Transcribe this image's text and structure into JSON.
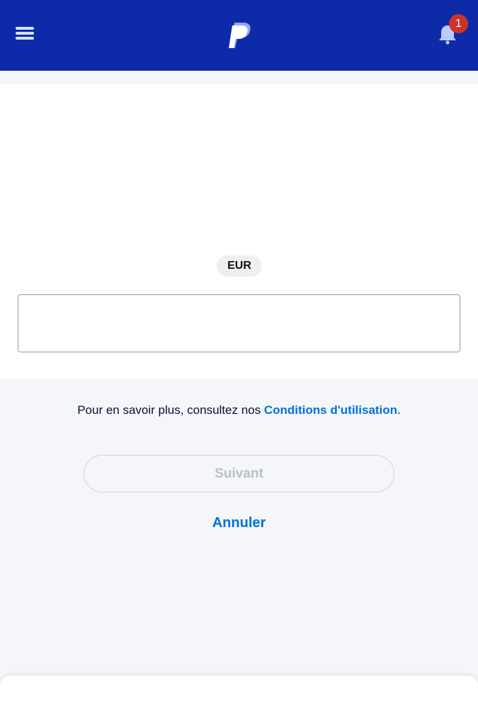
{
  "header": {
    "menu_icon": "hamburger-menu-icon",
    "logo_icon": "paypal-logo",
    "bell_icon": "notification-bell-icon",
    "notification_count": "1"
  },
  "amount": {
    "currency": "EUR",
    "value": ""
  },
  "footer": {
    "terms_prefix": "Pour en savoir plus, consultez nos ",
    "terms_link": "Conditions d'utilisation",
    "terms_suffix": ".",
    "next_label": "Suivant",
    "cancel_label": "Annuler"
  },
  "colors": {
    "header_bg": "#0f2aa8",
    "link": "#0070e0",
    "badge": "#d03228"
  }
}
